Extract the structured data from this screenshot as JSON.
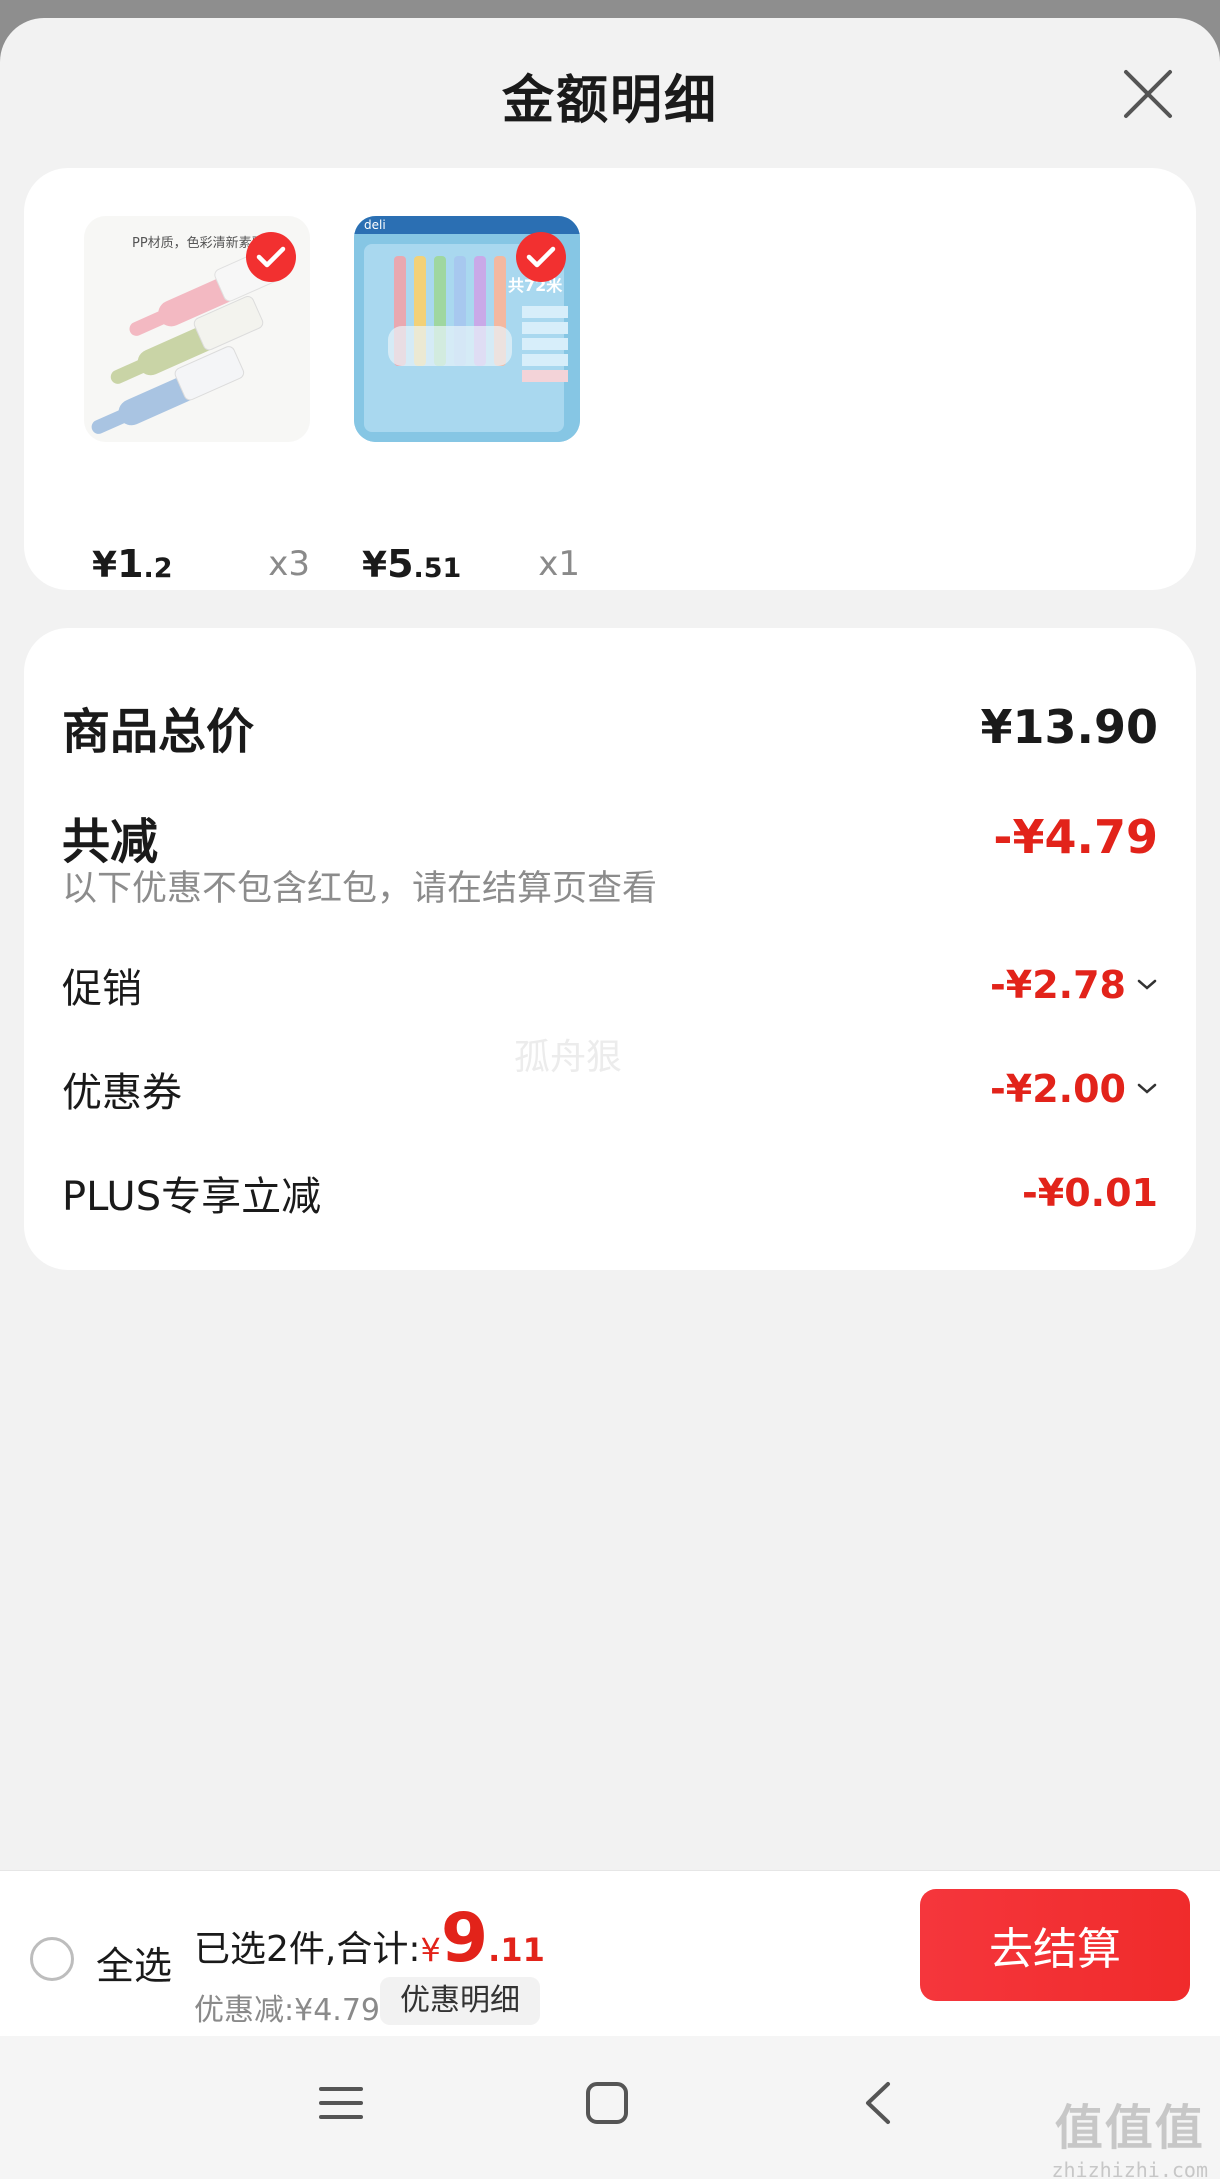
{
  "sheet": {
    "title": "金额明细"
  },
  "products": [
    {
      "currency": "¥",
      "price_int": "1",
      "price_dec": ".2",
      "qty": "x3",
      "image_text": "PP材质，色彩清新素雅"
    },
    {
      "currency": "¥",
      "price_int": "5",
      "price_dec": ".51",
      "qty": "x1",
      "image_text": "共72米",
      "brand_text": "deli"
    }
  ],
  "breakdown": {
    "total_label": "商品总价",
    "total_value": "¥13.90",
    "reduce_label": "共减",
    "reduce_value": "-¥4.79",
    "note": "以下优惠不包含红包，请在结算页查看",
    "items": [
      {
        "label": "促销",
        "value": "-¥2.78"
      },
      {
        "label": "优惠券",
        "value": "-¥2.00"
      },
      {
        "label": "PLUS专享立减",
        "value": "-¥0.01"
      }
    ],
    "watermark": "孤舟狠"
  },
  "bottom_bar": {
    "select_all": "全选",
    "selected_text": "已选2件,合计:",
    "currency": "¥",
    "total_int": "9",
    "total_dec": ".11",
    "discount_text": "优惠减:¥4.79",
    "detail_button": "优惠明细",
    "checkout_button": "去结算"
  },
  "site_brand": {
    "big": "值值值",
    "small": "zhizhizhi.com"
  },
  "colors": {
    "accent": "#e2231a",
    "checkout": "#f23030"
  }
}
